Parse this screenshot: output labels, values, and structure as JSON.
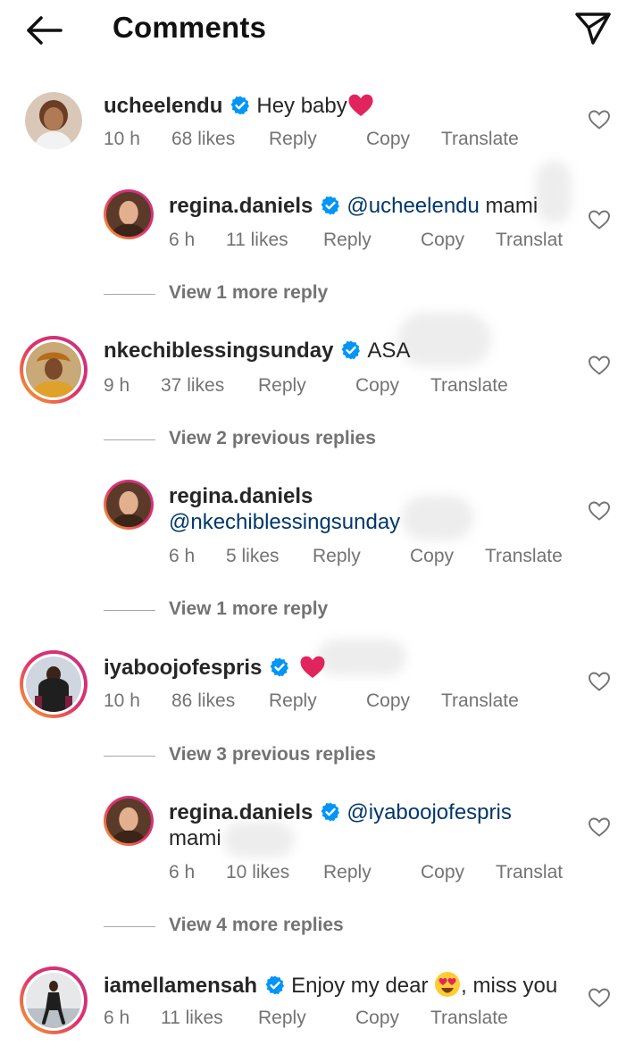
{
  "header": {
    "title": "Comments",
    "back_icon": "arrow-left-icon",
    "share_icon": "paper-plane-icon"
  },
  "colors": {
    "mention": "#00376b",
    "verified": "#0095f6",
    "meta": "#737373",
    "heart": "#e0245e"
  },
  "actions": {
    "reply": "Reply",
    "copy": "Copy",
    "translate": "Translate",
    "translate_truncated": "Translat"
  },
  "comments": [
    {
      "username": "ucheelendu",
      "text": "Hey baby",
      "time": "10 h",
      "likes": "68 likes"
    },
    {
      "username": "regina.daniels",
      "mention": "@ucheelendu",
      "text": "mami",
      "time": "6 h",
      "likes": "11 likes"
    },
    {
      "more": "View 1 more reply"
    },
    {
      "username": "nkechiblessingsunday",
      "text": "ASA",
      "time": "9 h",
      "likes": "37 likes"
    },
    {
      "more": "View 2 previous replies"
    },
    {
      "username": "regina.daniels",
      "mention": "@nkechiblessingsunday",
      "time": "6 h",
      "likes": "5 likes"
    },
    {
      "more": "View 1 more reply"
    },
    {
      "username": "iyaboojofespris",
      "time": "10 h",
      "likes": "86 likes"
    },
    {
      "more": "View 3 previous replies"
    },
    {
      "username": "regina.daniels",
      "mention": "@iyaboojofespris",
      "text": "mami",
      "time": "6 h",
      "likes": "10 likes"
    },
    {
      "more": "View 4 more replies"
    },
    {
      "username": "iamellamensah",
      "text": "Enjoy my dear",
      "text_after": ", miss you",
      "time": "6 h",
      "likes": "11 likes"
    }
  ]
}
